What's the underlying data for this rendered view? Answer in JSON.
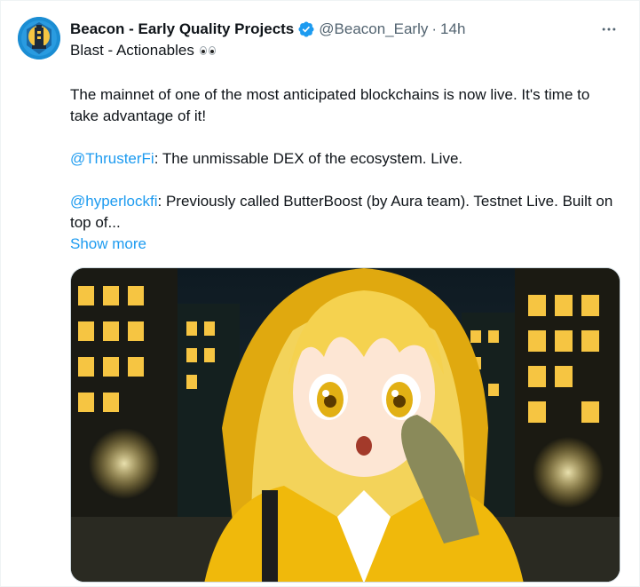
{
  "tweet": {
    "display_name": "Beacon - Early Quality Projects",
    "handle": "@Beacon_Early",
    "separator": "·",
    "time": "14h",
    "subtitle": "Blast - Actionables",
    "paragraphs": {
      "p1": "The mainnet of one of the most anticipated blockchains is now live. It's time to take advantage of it!",
      "p2_mention": "@ThrusterFi",
      "p2_text": ": The unmissable DEX of the ecosystem. Live.",
      "p3_mention": "@hyperlockfi",
      "p3_text": ": Previously called ButterBoost (by Aura team). Testnet Live. Built on top of..."
    },
    "show_more": "Show more"
  },
  "icons": {
    "verified": "verified-badge-icon",
    "more": "more-options-icon",
    "eyes": "eyes-emoji-icon"
  },
  "colors": {
    "link": "#1d9bf0",
    "verified": "#1d9bf0",
    "secondary_text": "#536471"
  }
}
